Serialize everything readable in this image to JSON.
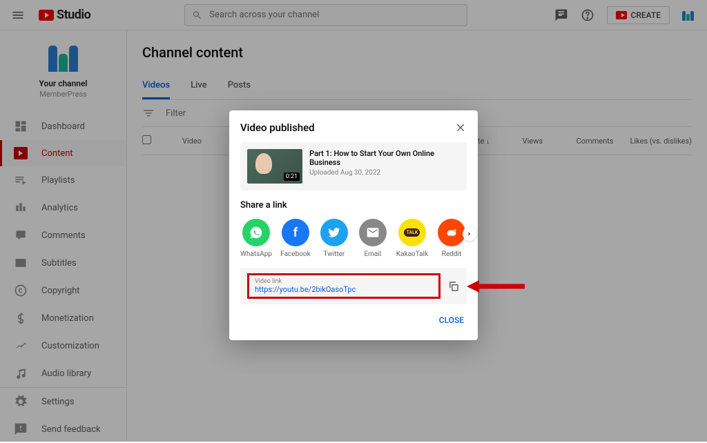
{
  "header": {
    "studio": "Studio",
    "search_placeholder": "Search across your channel",
    "create": "CREATE"
  },
  "channel": {
    "your_channel": "Your channel",
    "name": "MemberPress"
  },
  "nav": {
    "dashboard": "Dashboard",
    "content": "Content",
    "playlists": "Playlists",
    "analytics": "Analytics",
    "comments": "Comments",
    "subtitles": "Subtitles",
    "copyright": "Copyright",
    "monetization": "Monetization",
    "customization": "Customization",
    "audio": "Audio library",
    "settings": "Settings",
    "feedback": "Send feedback"
  },
  "page": {
    "title": "Channel content",
    "tabs": {
      "videos": "Videos",
      "live": "Live",
      "posts": "Posts"
    },
    "filter_placeholder": "Filter",
    "cols": {
      "video": "Video",
      "date": "Date",
      "views": "Views",
      "comments": "Comments",
      "likes": "Likes (vs. dislikes)"
    }
  },
  "dialog": {
    "title": "Video published",
    "video_title": "Part 1: How to Start Your Own Online Business",
    "video_sub": "Uploaded Aug 30, 2022",
    "duration": "0:21",
    "share": "Share a link",
    "whatsapp": "WhatsApp",
    "facebook": "Facebook",
    "twitter": "Twitter",
    "email": "Email",
    "kakaotalk": "KakaoTalk",
    "reddit": "Reddit",
    "kt_badge": "TALK",
    "link_label": "Video link",
    "link_url": "https://youtu.be/2bikOasoTpc",
    "close": "CLOSE"
  }
}
